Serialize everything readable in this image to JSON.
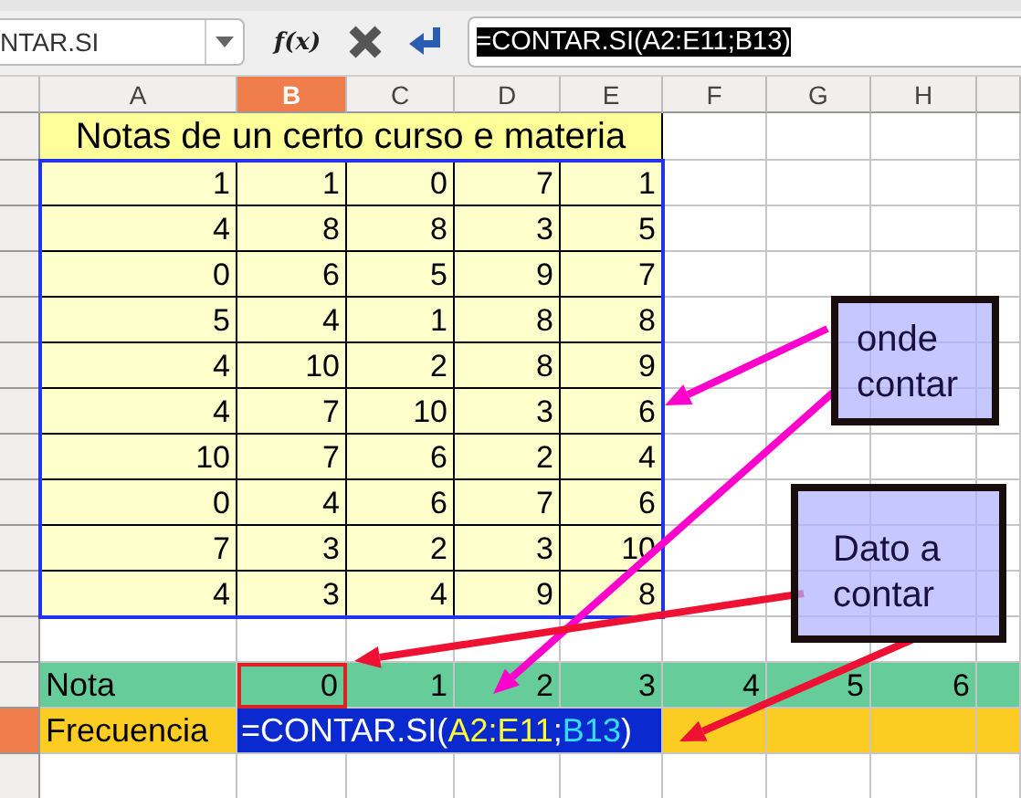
{
  "formula_bar": {
    "name_box": "NTAR.SI",
    "function_button": "f(x)",
    "formula": "=CONTAR.SI(A2:E11;B13)",
    "formula_selected": true
  },
  "columns": [
    {
      "label": "A",
      "selected": false
    },
    {
      "label": "B",
      "selected": true
    },
    {
      "label": "C",
      "selected": false
    },
    {
      "label": "D",
      "selected": false
    },
    {
      "label": "E",
      "selected": false
    },
    {
      "label": "F",
      "selected": false
    },
    {
      "label": "G",
      "selected": false
    },
    {
      "label": "H",
      "selected": false
    }
  ],
  "title": "Notas de un certo curso e materia",
  "data_rows": [
    [
      "1",
      "1",
      "0",
      "7",
      "1"
    ],
    [
      "4",
      "8",
      "8",
      "3",
      "5"
    ],
    [
      "0",
      "6",
      "5",
      "9",
      "7"
    ],
    [
      "5",
      "4",
      "1",
      "8",
      "8"
    ],
    [
      "4",
      "10",
      "2",
      "8",
      "9"
    ],
    [
      "4",
      "7",
      "10",
      "3",
      "6"
    ],
    [
      "10",
      "7",
      "6",
      "2",
      "4"
    ],
    [
      "0",
      "4",
      "6",
      "7",
      "6"
    ],
    [
      "7",
      "3",
      "2",
      "3",
      "10"
    ],
    [
      "4",
      "3",
      "4",
      "9",
      "8"
    ]
  ],
  "nota_row": {
    "label": "Nota",
    "values": [
      {
        "text": "0",
        "referenced": true
      },
      {
        "text": "1",
        "referenced": false
      },
      {
        "text": "2",
        "referenced": false
      },
      {
        "text": "3",
        "referenced": false
      },
      {
        "text": "4",
        "referenced": false
      },
      {
        "text": "5",
        "referenced": false
      },
      {
        "text": "6",
        "referenced": false
      }
    ]
  },
  "frecuencia_row": {
    "label": "Frecuencia",
    "selected": true,
    "formula_parts": [
      {
        "text": "=CONTAR.SI(",
        "kind": "plain"
      },
      {
        "text": "A2:E11",
        "kind": "range"
      },
      {
        "text": ";",
        "kind": "plain"
      },
      {
        "text": "B13",
        "kind": "reference"
      },
      {
        "text": ")",
        "kind": "plain"
      }
    ]
  },
  "callouts": [
    {
      "text": "onde contar"
    },
    {
      "text": "Dato a contar"
    }
  ],
  "arrows": [
    {
      "color": "#ff00cc"
    },
    {
      "color": "#ff00cc"
    },
    {
      "color": "#ee1133"
    },
    {
      "color": "#ee1133"
    }
  ]
}
